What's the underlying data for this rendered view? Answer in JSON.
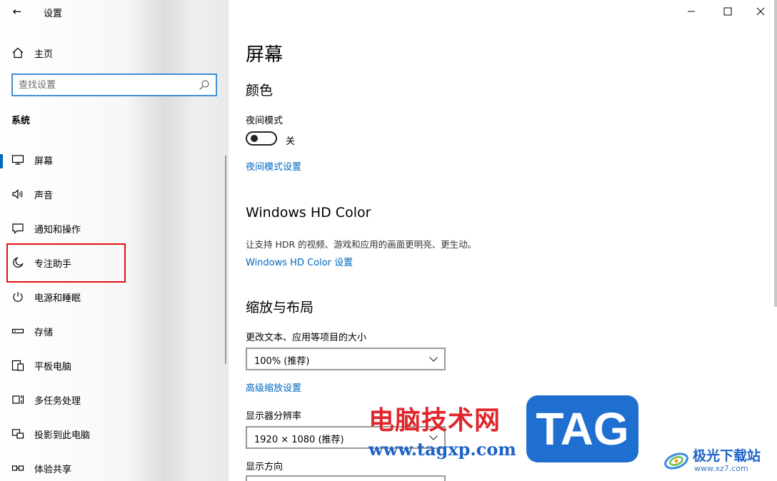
{
  "window": {
    "app_title": "设置",
    "back_glyph": "←"
  },
  "sidebar": {
    "home_label": "主页",
    "search_placeholder": "查找设置",
    "section_title": "系统",
    "items": [
      {
        "label": "屏幕",
        "icon": "monitor-icon",
        "selected": true
      },
      {
        "label": "声音",
        "icon": "speaker-icon"
      },
      {
        "label": "通知和操作",
        "icon": "notification-icon"
      },
      {
        "label": "专注助手",
        "icon": "moon-icon"
      },
      {
        "label": "电源和睡眠",
        "icon": "power-icon"
      },
      {
        "label": "存储",
        "icon": "storage-icon"
      },
      {
        "label": "平板电脑",
        "icon": "tablet-icon"
      },
      {
        "label": "多任务处理",
        "icon": "multitask-icon"
      },
      {
        "label": "投影到此电脑",
        "icon": "project-icon"
      },
      {
        "label": "体验共享",
        "icon": "share-icon"
      }
    ]
  },
  "main": {
    "page_title": "屏幕",
    "color_heading": "颜色",
    "night_mode_label": "夜间模式",
    "night_mode_state": "关",
    "night_mode_link": "夜间模式设置",
    "hdr_heading": "Windows HD Color",
    "hdr_desc": "让支持 HDR 的视频、游戏和应用的画面更明亮、更生动。",
    "hdr_link": "Windows HD Color 设置",
    "scale_heading": "缩放与布局",
    "scale_label": "更改文本、应用等项目的大小",
    "scale_value": "100% (推荐)",
    "advanced_scale_link": "高级缩放设置",
    "resolution_label": "显示器分辨率",
    "resolution_value": "1920 × 1080 (推荐)",
    "orientation_label": "显示方向"
  },
  "watermark": {
    "site_name": "电脑技术网",
    "site_url": "www.tagxp.com",
    "tag": "TAG",
    "logo_name": "极光下载站",
    "logo_url": "www.xz7.com"
  },
  "colors": {
    "accent": "#0067c0",
    "highlight": "#e01010"
  }
}
